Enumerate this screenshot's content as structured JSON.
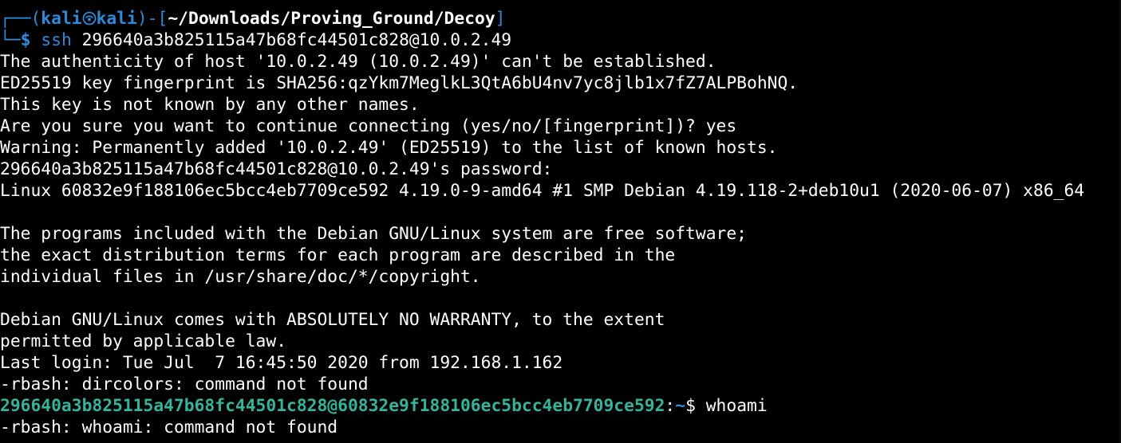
{
  "prompt": {
    "corner_top": "┌──(",
    "user": "kali",
    "host": "kali",
    "close_open": ")-[",
    "path": "~/Downloads/Proving_Ground/Decoy",
    "bracket_close": "]",
    "corner_bottom": "└─",
    "dollar": "$",
    "command_name": "ssh",
    "command_args": " 296640a3b825115a47b68fc44501c828@10.0.2.49"
  },
  "output": [
    "The authenticity of host '10.0.2.49 (10.0.2.49)' can't be established.",
    "ED25519 key fingerprint is SHA256:qzYkm7MeglkL3QtA6bU4nv7yc8jlb1x7fZ7ALPBohNQ.",
    "This key is not known by any other names.",
    "Are you sure you want to continue connecting (yes/no/[fingerprint])? yes",
    "Warning: Permanently added '10.0.2.49' (ED25519) to the list of known hosts.",
    "296640a3b825115a47b68fc44501c828@10.0.2.49's password:",
    "Linux 60832e9f188106ec5bcc4eb7709ce592 4.19.0-9-amd64 #1 SMP Debian 4.19.118-2+deb10u1 (2020-06-07) x86_64",
    "",
    "The programs included with the Debian GNU/Linux system are free software;",
    "the exact distribution terms for each program are described in the",
    "individual files in /usr/share/doc/*/copyright.",
    "",
    "Debian GNU/Linux comes with ABSOLUTELY NO WARRANTY, to the extent",
    "permitted by applicable law.",
    "Last login: Tue Jul  7 16:45:50 2020 from 192.168.1.162",
    "-rbash: dircolors: command not found"
  ],
  "remote_prompt": {
    "userhost": "296640a3b825115a47b68fc44501c828@60832e9f188106ec5bcc4eb7709ce592",
    "colon": ":",
    "path": "~",
    "dollar": "$",
    "command": " whoami"
  },
  "after_whoami": "-rbash: whoami: command not found",
  "icons": {
    "prompt_separator": "kali-skull-icon"
  },
  "colors": {
    "background": "#000000",
    "prompt_blue": "#2f8ad8",
    "remote_green": "#36b39a",
    "text": "#ffffff"
  }
}
